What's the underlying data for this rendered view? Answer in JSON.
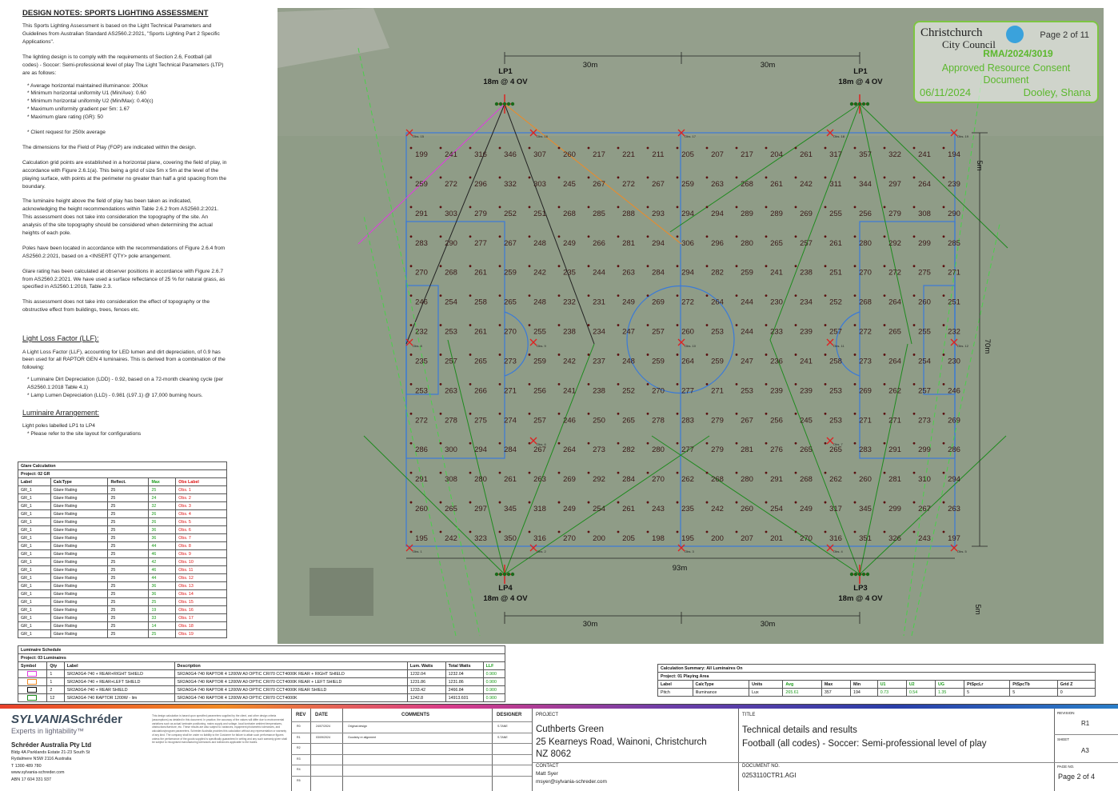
{
  "notes": {
    "title": "DESIGN NOTES: SPORTS LIGHTING ASSESSMENT",
    "p1": "This Sports Lighting Assessment is based on the Light Technical Parameters and Guidelines from Australian Standard AS2560.2:2021, \"Sports Lighting Part 2 Specific Applications\".",
    "p2": "The lighting design is to comply with the requirements of Section 2.6, Football (all codes) - Soccer: Semi-professional level of play The Light Technical Parameters (LTP) are as follows:",
    "ltp": [
      "Average horizontal maintained illuminance: 200lux",
      "Minimum horizontal uniformity U1 (Min/Ave): 0.60",
      "Minimum horizontal uniformity U2 (Min/Max): 0.40(c)",
      "Maximum uniformity gradient per 5m: 1.67",
      "Maximum glare rating (GR): 50"
    ],
    "client": "Client request for 250lx average",
    "p3": "The dimensions for the Field of Play (FOP) are indicated within the design.",
    "p4": "Calculation grid points are established in a horizontal plane, covering the field of play, in accordance with Figure 2.6.1(a). This being a grid of size 5m x 5m at the level of the playing surface, with points at the perimeter no greater than half a grid spacing from the boundary.",
    "p5": "The luminaire height above the field of play has been taken as indicated, acknowledging the height recommendations within Table 2.6.2 from AS2560.2:2021. This assessment does not take into consideration the topography of the site. An analysis of the site topography should be considered when determining the actual heights of each pole.",
    "p6": "Poles have been located in accordance with the recommendations of Figure 2.6.4 from AS2560.2:2021, based on a <INSERT QTY> pole arrangement.",
    "p7": "Glare rating has been calculated at observer positions in accordance with Figure 2.6.7 from AS2560.2:2021. We have used a surface reflectance of 25 % for natural grass, as specified in AS2560.1:2018, Table 2.3.",
    "p8": "This assessment does not take into consideration the effect of topography or the obstructive effect from buildings, trees, fences etc.",
    "llf_title": "Light Loss Factor (LLF):",
    "llf_p": "A Light Loss Factor (LLF), accounting for LED lumen and dirt depreciation, of 0.9 has been used for all RAPTOR GEN 4 luminaires. This is derived from a combination of the following:",
    "llf_items": [
      "Luminaire Dirt Depreciation (LDD) - 0.92, based on a 72-month cleaning cycle (per AS2560.1:2018 Table 4.1)",
      "Lamp Lumen Depreciation (LLD) - 0.981 (L97.1) @ 17,000 burning hours."
    ],
    "arr_title": "Luminaire Arrangement:",
    "arr_p1": "Light poles labelled LP1 to LP4",
    "arr_p2": "Please refer to the site layout for configurations"
  },
  "glare": {
    "title": "Glare Calculation",
    "project": "Project: 02 GR",
    "headers": [
      "Label",
      "CalcType",
      "Reflect.",
      "Max",
      "Obs Label"
    ],
    "rows": [
      [
        "GR_1",
        "Glare Rating",
        "25",
        "25",
        "Obs. 1"
      ],
      [
        "GR_1",
        "Glare Rating",
        "25",
        "24",
        "Obs. 2"
      ],
      [
        "GR_1",
        "Glare Rating",
        "25",
        "32",
        "Obs. 3"
      ],
      [
        "GR_1",
        "Glare Rating",
        "25",
        "26",
        "Obs. 4"
      ],
      [
        "GR_1",
        "Glare Rating",
        "25",
        "26",
        "Obs. 5"
      ],
      [
        "GR_1",
        "Glare Rating",
        "25",
        "36",
        "Obs. 6"
      ],
      [
        "GR_1",
        "Glare Rating",
        "25",
        "36",
        "Obs. 7"
      ],
      [
        "GR_1",
        "Glare Rating",
        "25",
        "44",
        "Obs. 8"
      ],
      [
        "GR_1",
        "Glare Rating",
        "25",
        "46",
        "Obs. 9"
      ],
      [
        "GR_1",
        "Glare Rating",
        "25",
        "42",
        "Obs. 10"
      ],
      [
        "GR_1",
        "Glare Rating",
        "25",
        "46",
        "Obs. 11"
      ],
      [
        "GR_1",
        "Glare Rating",
        "25",
        "44",
        "Obs. 12"
      ],
      [
        "GR_1",
        "Glare Rating",
        "25",
        "36",
        "Obs. 13"
      ],
      [
        "GR_1",
        "Glare Rating",
        "25",
        "36",
        "Obs. 14"
      ],
      [
        "GR_1",
        "Glare Rating",
        "25",
        "25",
        "Obs. 15"
      ],
      [
        "GR_1",
        "Glare Rating",
        "25",
        "19",
        "Obs. 16"
      ],
      [
        "GR_1",
        "Glare Rating",
        "25",
        "33",
        "Obs. 17"
      ],
      [
        "GR_1",
        "Glare Rating",
        "25",
        "14",
        "Obs. 18"
      ],
      [
        "GR_1",
        "Glare Rating",
        "25",
        "25",
        "Obs. 19"
      ]
    ]
  },
  "schedule": {
    "title": "Luminaire Schedule",
    "project": "Project: 03 Luminaires",
    "headers": [
      "Symbol",
      "Qty",
      "Label",
      "Description",
      "Lum. Watts",
      "Total Watts",
      "LLF"
    ],
    "rows": [
      {
        "color": "#e03ce0",
        "qty": "1",
        "label": "SR2A0G4-740 + REAR+RIGHT SHIELD",
        "desc": "SR2A0G4-740 RAPTOR 4 1200W A0 OPTIC CRI70 CCT4000K REAR + RIGHT SHIELD",
        "lw": "1232.04",
        "tw": "1232.04",
        "llf": "0.900"
      },
      {
        "color": "#f08a24",
        "qty": "1",
        "label": "SR2A0G4-740 + REAR+LEFT SHIELD",
        "desc": "SR2A0G4-740 RAPTOR 4 1200W A0 OPTIC CRI70 CCT4000K REAR + LEFT SHIELD",
        "lw": "1231.86",
        "tw": "1231.86",
        "llf": "0.900"
      },
      {
        "color": "#111111",
        "qty": "2",
        "label": "SR2A0G4-740 + REAR SHIELD",
        "desc": "SR2A0G4-740 RAPTOR 4 1200W A0 OPTIC CRI70 CCT4000K REAR SHIELD",
        "lw": "1233.42",
        "tw": "2466.84",
        "llf": "0.900"
      },
      {
        "color": "#1a8a1a",
        "qty": "12",
        "label": "SR2A0G4-740 RAPTOR 1200W - lim",
        "desc": "SR2A0G4-740 RAPTOR 4 1200W A0 OPTIC CRI70 CCT4000K",
        "lw": "1242.8",
        "tw": "14913.601",
        "llf": "0.900"
      }
    ]
  },
  "calc_summary": {
    "title": "Calculation Summary: All Luminaires On",
    "project": "Project: 01 Playing Area",
    "headers": [
      "Label",
      "CalcType",
      "Units",
      "Avg",
      "Max",
      "Min",
      "U1",
      "U2",
      "UG",
      "PtSpcLr",
      "PtSpcTb",
      "Grid Z"
    ],
    "row": [
      "Pitch",
      "Illuminance",
      "Lux",
      "265.61",
      "357",
      "194",
      "0.73",
      "0.54",
      "1.35",
      "5",
      "5",
      "0"
    ]
  },
  "stamp": {
    "council_1": "Christchurch",
    "council_2": "City Council",
    "page": "Page 2 of 11",
    "rma": "RMA/2024/3019",
    "approved_1": "Approved Resource Consent",
    "approved_2": "Document",
    "date": "06/11/2024",
    "name": "Dooley, Shana"
  },
  "poles": [
    {
      "id": "LP1",
      "spec": "18m @ 4 OV"
    },
    {
      "id": "LP1",
      "spec": "18m @ 4 OV"
    },
    {
      "id": "LP4",
      "spec": "18m @ 4 OV"
    },
    {
      "id": "LP3",
      "spec": "18m @ 4 OV"
    }
  ],
  "dims": {
    "top_left": "30m",
    "top_right": "30m",
    "bottom_left": "30m",
    "bottom_right": "30m",
    "width": "93m",
    "height": "70m",
    "top_side": "5m",
    "bottom_side": "5m"
  },
  "grid": [
    [
      199,
      241,
      316,
      346,
      307,
      260,
      217,
      221,
      211,
      205,
      207,
      217,
      204,
      261,
      317,
      357,
      322,
      241,
      194
    ],
    [
      259,
      272,
      296,
      332,
      303,
      245,
      267,
      272,
      267,
      259,
      263,
      268,
      261,
      242,
      311,
      344,
      297,
      264,
      239
    ],
    [
      291,
      303,
      279,
      252,
      251,
      268,
      285,
      288,
      293,
      294,
      294,
      289,
      289,
      269,
      255,
      256,
      279,
      308,
      290
    ],
    [
      283,
      290,
      277,
      267,
      248,
      249,
      266,
      281,
      294,
      306,
      296,
      280,
      265,
      257,
      261,
      280,
      292,
      299,
      285
    ],
    [
      270,
      268,
      261,
      259,
      242,
      235,
      244,
      263,
      284,
      294,
      282,
      259,
      241,
      238,
      251,
      270,
      272,
      275,
      271
    ],
    [
      246,
      254,
      258,
      265,
      248,
      232,
      231,
      249,
      269,
      272,
      264,
      244,
      230,
      234,
      252,
      268,
      264,
      260,
      251
    ],
    [
      232,
      253,
      261,
      270,
      255,
      238,
      234,
      247,
      257,
      260,
      253,
      244,
      233,
      239,
      257,
      272,
      265,
      255,
      232
    ],
    [
      235,
      257,
      265,
      273,
      259,
      242,
      237,
      248,
      259,
      264,
      259,
      247,
      236,
      241,
      258,
      273,
      264,
      254,
      230
    ],
    [
      253,
      263,
      266,
      271,
      256,
      241,
      238,
      252,
      270,
      277,
      271,
      253,
      239,
      239,
      253,
      269,
      262,
      257,
      246
    ],
    [
      272,
      278,
      275,
      274,
      257,
      246,
      250,
      265,
      278,
      283,
      279,
      267,
      256,
      245,
      253,
      271,
      271,
      273,
      269
    ],
    [
      286,
      300,
      294,
      284,
      267,
      264,
      273,
      282,
      280,
      277,
      279,
      281,
      276,
      265,
      265,
      283,
      291,
      299,
      286
    ],
    [
      291,
      308,
      280,
      261,
      263,
      269,
      292,
      284,
      270,
      262,
      268,
      280,
      291,
      268,
      262,
      260,
      281,
      310,
      294
    ],
    [
      260,
      265,
      297,
      345,
      318,
      249,
      254,
      261,
      243,
      235,
      242,
      260,
      254,
      249,
      317,
      345,
      299,
      267,
      263
    ],
    [
      195,
      242,
      323,
      350,
      316,
      270,
      200,
      205,
      198,
      195,
      200,
      207,
      201,
      270,
      316,
      351,
      326,
      243,
      197
    ]
  ],
  "obs_labels": [
    "Obs. 15",
    "Obs. 16",
    "Obs. 17",
    "Obs. 18",
    "Obs. 19",
    "Obs. 8",
    "Obs. 9",
    "Obs. 10",
    "Obs. 11",
    "Obs. 12",
    "Obs. 6",
    "Obs. 7",
    "Obs. 1",
    "Obs. 2",
    "Obs. 3",
    "Obs. 4",
    "Obs. 5"
  ],
  "footer": {
    "brand_1": "SYLVANIA",
    "brand_2": "Schréder",
    "tagline": "Experts in lightability™",
    "company": "Schréder Australia Pty Ltd",
    "addr1": "Bldg 4A Parklands Estate 21-23 South St",
    "addr2": "Rydalmere NSW 2116 Australia",
    "phone": "T 1300 489 780",
    "web": "www.sylvania-schreder.com",
    "abn": "ABN 17 604 331 937",
    "disclaimer": "This design calculation is based upon specified parameters supplied by the client, and other design criteria (assumptions) as detailed in this document. In practice, the accuracy of the values will differ due to environmental variations such as actual luminaire positioning, mains supply and voltage, local luminaire ambient temperatures, obstructions/furniture, etc. These results are also subject to variances, equipment photometric tolerances, and calculation/program parameters. Schréder Australia provides this calculation without any representation or warranty of any kind. The company shall be under no liability to the Customer for failure to attain such performance figures unless the performance of the goods supplied is specifically guaranteed in writing and any such warranty given shall be subject to recognised manufacturing tolerances and tolerances applicable to the trades.",
    "rev_headers": [
      "REV",
      "DATE",
      "COMMENTS",
      "DESIGNER"
    ],
    "revs": [
      [
        "R0",
        "24/07/2024",
        "Original design",
        "S.TANE"
      ],
      [
        "R1",
        "03/09/2024",
        "Goodsby re alignment",
        "S.TANE"
      ],
      [
        "R2",
        "",
        "",
        ""
      ],
      [
        "R3",
        "",
        "",
        ""
      ],
      [
        "R4",
        "",
        "",
        ""
      ],
      [
        "R5",
        "",
        "",
        ""
      ]
    ],
    "project_label": "PROJECT",
    "project_1": "Cuthberts Green",
    "project_2": "25 Kearneys Road, Wainoni, Christchurch",
    "project_3": "NZ 8062",
    "contact_label": "CONTACT",
    "contact_name": "Matt Syer",
    "contact_email": "msyer@sylvania-schreder.com",
    "title_label": "TITLE",
    "title_1": "Technical details and results",
    "title_2": "Football (all codes) - Soccer: Semi-professional level of play",
    "docno_label": "DOCUMENT NO.",
    "docno": "0253110CTR1.AGI",
    "revision_label": "REVISION",
    "revision": "R1",
    "sheet_label": "SHEET",
    "sheet": "A3",
    "pageno_label": "PAGE NO.",
    "pageno": "Page 2 of 4"
  }
}
